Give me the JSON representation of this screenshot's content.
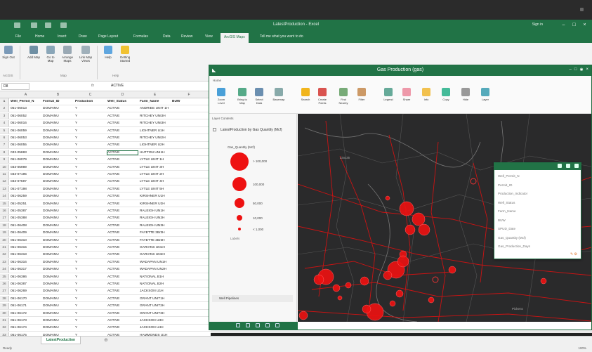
{
  "app": {
    "title": "LatestProduction - Excel",
    "sign_in": "Sign in",
    "tell_me": "Tell me what you want to do",
    "window_controls": [
      "minimize-icon",
      "restore-icon",
      "close-icon"
    ]
  },
  "ribbon_tabs": [
    "File",
    "Home",
    "Insert",
    "Draw",
    "Page Layout",
    "Formulas",
    "Data",
    "Review",
    "View",
    "ArcGIS Maps"
  ],
  "ribbon_active": "ArcGIS Maps",
  "ribbon_buttons": [
    {
      "label": "Sign Out",
      "icon": "user-icon"
    },
    {
      "label": "Add Map",
      "icon": "map-icon"
    },
    {
      "label": "Go to Map",
      "icon": "map-go-icon"
    },
    {
      "label": "Arrange Maps",
      "icon": "arrange-icon"
    },
    {
      "label": "Link Map Views",
      "icon": "link-icon"
    },
    {
      "label": "Help",
      "icon": "help-icon"
    },
    {
      "label": "Getting Started",
      "icon": "bulb-icon"
    }
  ],
  "ribbon_groups": [
    "ArcGIS",
    "Map",
    "Help"
  ],
  "formula_bar": {
    "name_box": "D8",
    "fx": "fx",
    "value": "ACTIVE"
  },
  "grid": {
    "columns": [
      "A",
      "B",
      "C",
      "D",
      "E",
      "F"
    ],
    "header_row": [
      "Well_Permit_N",
      "Formal_ID",
      "Production",
      "Well_Status",
      "Farm_Name",
      "BUW"
    ],
    "rows": [
      [
        "051-06013",
        "DOMAINU",
        "Y",
        "ACTIVE",
        "ANDRIEE UNIT 1H"
      ],
      [
        "051-06052",
        "DOMAINU",
        "Y",
        "ACTIVE",
        "RITCHEY UNI3H"
      ],
      [
        "051-06016",
        "DOMAINU",
        "Y",
        "ACTIVE",
        "RITCHEY UNI3H"
      ],
      [
        "051-06059",
        "DOMAINU",
        "Y",
        "ACTIVE",
        "LIGHTNER U1H"
      ],
      [
        "051-06053",
        "DOMAINU",
        "Y",
        "ACTIVE",
        "RITCHEY UNI2H"
      ],
      [
        "051-06055",
        "DOMAINU",
        "Y",
        "ACTIVE",
        "LIGHTNER U2H"
      ],
      [
        "033-05883",
        "DOMAINU",
        "Y",
        "ACTIVE",
        "HUTTON UNI1H"
      ],
      [
        "051-06079",
        "DOMAINU",
        "Y",
        "ACTIVE",
        "LYTLE UNIT 1H"
      ],
      [
        "033-05989",
        "DOMAINU",
        "Y",
        "ACTIVE",
        "LYTLE UNIT 3H"
      ],
      [
        "033-07195",
        "DOMAINU",
        "Y",
        "ACTIVE",
        "LYTLE UNIT 2H"
      ],
      [
        "033-07597",
        "DOMAINU",
        "Y",
        "ACTIVE",
        "LYTLE UNIT 4H"
      ],
      [
        "051-07198",
        "DOMAINU",
        "Y",
        "ACTIVE",
        "LYTLE UNIT 5H"
      ],
      [
        "051-06259",
        "DOMAINU",
        "Y",
        "ACTIVE",
        "KIRSHNER U1H"
      ],
      [
        "051-05251",
        "DOMAINU",
        "Y",
        "ACTIVE",
        "KIRSHNER U2H"
      ],
      [
        "051-05387",
        "DOMAINU",
        "Y",
        "ACTIVE",
        "RALEIGH UN1H"
      ],
      [
        "051-05388",
        "DOMAINU",
        "Y",
        "ACTIVE",
        "RALEIGH UN2H"
      ],
      [
        "051-06408",
        "DOMAINU",
        "Y",
        "ACTIVE",
        "RALEIGH UN3H"
      ],
      [
        "051-06409",
        "DOMAINU",
        "Y",
        "ACTIVE",
        "FAYETTE 3B/3H"
      ],
      [
        "051-06310",
        "DOMAINU",
        "Y",
        "ACTIVE",
        "FAYETTE 3B/3H"
      ],
      [
        "051-06315",
        "DOMAINU",
        "Y",
        "ACTIVE",
        "GARVINS UN1H"
      ],
      [
        "051-06318",
        "DOMAINU",
        "Y",
        "ACTIVE",
        "GARVINS UN2H"
      ],
      [
        "051-06316",
        "DOMAINU",
        "Y",
        "ACTIVE",
        "WADAPAN UN1H"
      ],
      [
        "051-06317",
        "DOMAINU",
        "Y",
        "ACTIVE",
        "WADAPAN UN2H"
      ],
      [
        "051-06386",
        "DOMAINU",
        "Y",
        "ACTIVE",
        "NATIONAL B1H"
      ],
      [
        "051-06387",
        "DOMAINU",
        "Y",
        "ACTIVE",
        "NATIONAL B2H"
      ],
      [
        "051-06269",
        "DOMAINU",
        "Y",
        "ACTIVE",
        "JACKSON U1H"
      ],
      [
        "051-06170",
        "DOMAINU",
        "Y",
        "ACTIVE",
        "GRANT UNIT1H"
      ],
      [
        "051-06171",
        "DOMAINU",
        "Y",
        "ACTIVE",
        "GRANT UNIT2H"
      ],
      [
        "051-06172",
        "DOMAINU",
        "Y",
        "ACTIVE",
        "GRANT UNIT3H"
      ],
      [
        "051-06173",
        "DOMAINU",
        "Y",
        "ACTIVE",
        "JACKSON U3H"
      ],
      [
        "051-06174",
        "DOMAINU",
        "Y",
        "ACTIVE",
        "JACKSON U4H"
      ],
      [
        "051-06175",
        "DOMAINU",
        "Y",
        "ACTIVE",
        "HAMMONDS U1H"
      ]
    ]
  },
  "sheet_tab": "LatestProduction",
  "status": {
    "left": "Ready",
    "zoom": "100%"
  },
  "map_window": {
    "title": "Gas Production (gas)",
    "ribbon_tab": "Home",
    "buttons": [
      "Zoom Level",
      "Bring to Map",
      "Select Data",
      "Basemap",
      "Search",
      "Create Points",
      "Find Nearby",
      "Filter",
      "Legend",
      "Share",
      "Info",
      "Copy",
      "Hide",
      "Layer"
    ],
    "layers_header": "Layer Contents",
    "layer1": "LatestProduction by Gas Quantity (Mcf)",
    "size_field": "Gas_Quantity (Mcf)",
    "legend": [
      "> 100,000",
      "100,000",
      "50,000",
      "10,000",
      "< 1,000"
    ],
    "legend_caption": "Labels",
    "layer2": "Well Pipelines",
    "fields": [
      "Well_Permit_N",
      "Permit_ID",
      "Production_Indicator",
      "Well_Status",
      "Farm_Name",
      "BUW",
      "SPUD_Date",
      "Gas_Quantity (Mcf)",
      "Gas_Production_Days"
    ],
    "map_labels": [
      "Lincoln",
      "Wheeling",
      "Pickens"
    ]
  },
  "colors": {
    "excel_green": "#217346",
    "map_bg": "#2a2a2b",
    "marker": "#ee1111"
  }
}
